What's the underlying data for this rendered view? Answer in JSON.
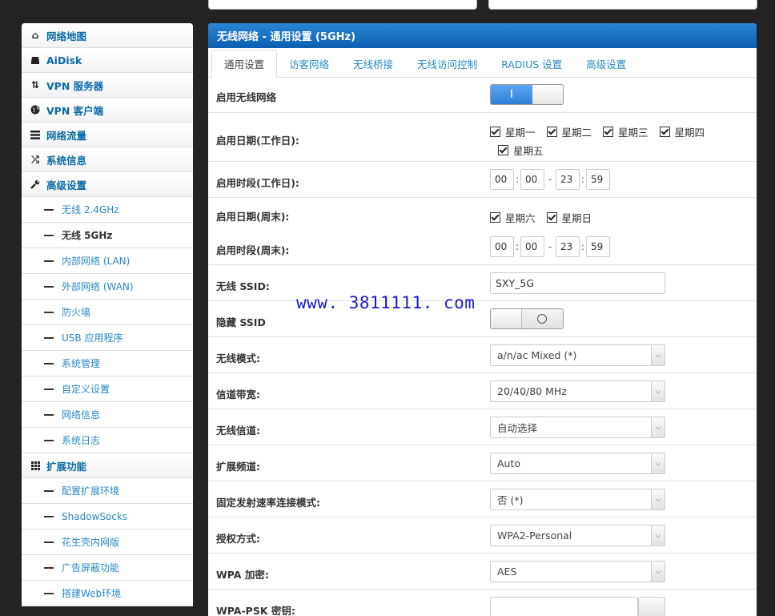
{
  "sidebar": {
    "items": [
      {
        "label": "网络地图",
        "icon": "home-icon"
      },
      {
        "label": "AiDisk",
        "icon": "disk-icon"
      },
      {
        "label": "VPN 服务器",
        "icon": "retweet-icon"
      },
      {
        "label": "VPN 客户端",
        "icon": "globe-icon"
      },
      {
        "label": "网络流量",
        "icon": "list-icon"
      },
      {
        "label": "系统信息",
        "icon": "shuffle-icon"
      },
      {
        "label": "高级设置",
        "icon": "wrench-icon"
      }
    ],
    "advanced_sub": [
      "无线 2.4GHz",
      "无线 5GHz",
      "内部网络 (LAN)",
      "外部网络 (WAN)",
      "防火墙",
      "USB 应用程序",
      "系统管理",
      "自定义设置",
      "网络信息",
      "系统日志"
    ],
    "extension": {
      "label": "扩展功能",
      "icon": "grid-icon"
    },
    "extension_sub": [
      "配置扩展环境",
      "ShadowSocks",
      "花生壳内网版",
      "广告屏蔽功能",
      "搭建Web环境"
    ]
  },
  "panel": {
    "title": "无线网络 - 通用设置 (5GHz)",
    "tabs": [
      "通用设置",
      "访客网络",
      "无线桥接",
      "无线访问控制",
      "RADIUS 设置",
      "高级设置"
    ]
  },
  "form": {
    "enable_wireless": {
      "label": "启用无线网络",
      "toggle_on": "I"
    },
    "weekday_days": {
      "label": "启用日期(工作日):",
      "days": [
        "星期一",
        "星期二",
        "星期三",
        "星期四",
        "星期五"
      ]
    },
    "weekday_time": {
      "label": "启用时段(工作日):",
      "start_h": "00",
      "start_m": "00",
      "end_h": "23",
      "end_m": "59",
      "colon": ":",
      "dash": "-"
    },
    "weekend_days": {
      "label": "启用日期(周末):",
      "days": [
        "星期六",
        "星期日"
      ]
    },
    "weekend_time": {
      "label": "启用时段(周末):",
      "start_h": "00",
      "start_m": "00",
      "end_h": "23",
      "end_m": "59"
    },
    "ssid": {
      "label": "无线 SSID:",
      "value": "SXY_5G"
    },
    "hide_ssid": {
      "label": "隐藏 SSID"
    },
    "mode": {
      "label": "无线模式:",
      "value": "a/n/ac Mixed (*)"
    },
    "bandwidth": {
      "label": "信道带宽:",
      "value": "20/40/80 MHz"
    },
    "channel": {
      "label": "无线信道:",
      "value": "自动选择"
    },
    "ext_channel": {
      "label": "扩展频道:",
      "value": "Auto"
    },
    "fixed_rate": {
      "label": "固定发射速率连接模式:",
      "value": "否 (*)"
    },
    "auth": {
      "label": "授权方式:",
      "value": "WPA2-Personal"
    },
    "wpa_enc": {
      "label": "WPA 加密:",
      "value": "AES"
    },
    "wpa_psk": {
      "label": "WPA-PSK 密钥:"
    }
  },
  "watermark": "www. 3811111. com"
}
